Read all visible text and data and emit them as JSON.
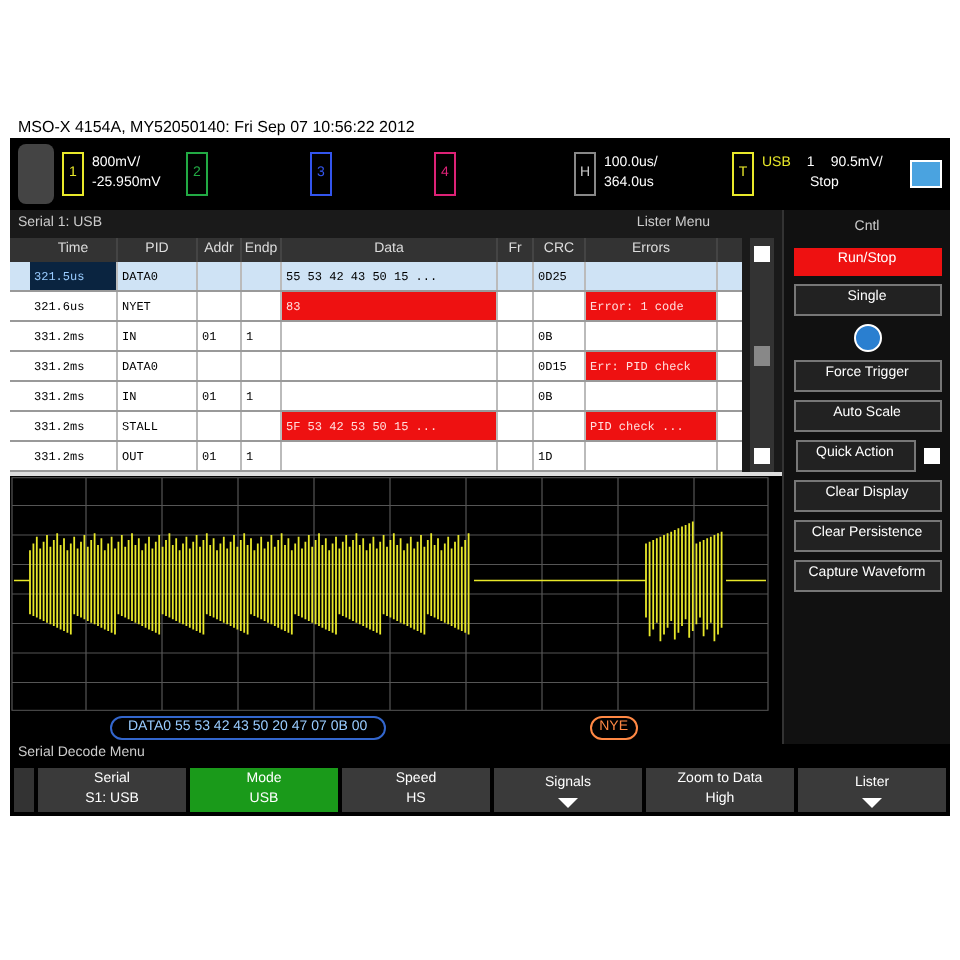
{
  "header": "MSO-X 4154A, MY52050140: Fri Sep 07 10:56:22 2012",
  "channels": [
    {
      "label": "1",
      "color": "#e8e82a",
      "scale": "800mV/",
      "offset": "-25.950mV"
    },
    {
      "label": "2",
      "color": "#22aa44"
    },
    {
      "label": "3",
      "color": "#3355ee"
    },
    {
      "label": "4",
      "color": "#dd2277"
    }
  ],
  "horizontal": {
    "label": "H",
    "scale": "100.0us/",
    "position": "364.0us"
  },
  "trigger": {
    "label": "T",
    "source": "1",
    "mode": "USB",
    "level": "90.5mV/",
    "status": "Stop"
  },
  "lister": {
    "title": "Serial 1: USB",
    "menu": "Lister Menu",
    "columns": [
      "Time",
      "PID",
      "Addr",
      "Endp",
      "Data",
      "Fr",
      "CRC",
      "Errors"
    ],
    "rows": [
      {
        "selected": true,
        "cells": [
          {
            "text": "321.5us"
          },
          {
            "text": "DATA0"
          },
          {
            "text": ""
          },
          {
            "text": ""
          },
          {
            "text": "55 53 42 43 50 15 ..."
          },
          {
            "text": ""
          },
          {
            "text": "0D25"
          },
          {
            "text": ""
          }
        ]
      },
      {
        "selected": false,
        "cells": [
          {
            "text": "321.6us"
          },
          {
            "text": "NYET"
          },
          {
            "text": ""
          },
          {
            "text": ""
          },
          {
            "text": "83",
            "error": true
          },
          {
            "text": ""
          },
          {
            "text": ""
          },
          {
            "text": "Error: 1 code",
            "error": true
          }
        ]
      },
      {
        "selected": false,
        "cells": [
          {
            "text": "331.2ms"
          },
          {
            "text": "IN"
          },
          {
            "text": "01"
          },
          {
            "text": "1"
          },
          {
            "text": ""
          },
          {
            "text": ""
          },
          {
            "text": "0B"
          },
          {
            "text": ""
          }
        ]
      },
      {
        "selected": false,
        "cells": [
          {
            "text": "331.2ms"
          },
          {
            "text": "DATA0"
          },
          {
            "text": ""
          },
          {
            "text": ""
          },
          {
            "text": ""
          },
          {
            "text": ""
          },
          {
            "text": "0D15"
          },
          {
            "text": "Err: PID check",
            "error": true
          }
        ]
      },
      {
        "selected": false,
        "cells": [
          {
            "text": "331.2ms"
          },
          {
            "text": "IN"
          },
          {
            "text": "01"
          },
          {
            "text": "1"
          },
          {
            "text": ""
          },
          {
            "text": ""
          },
          {
            "text": "0B"
          },
          {
            "text": ""
          }
        ]
      },
      {
        "selected": false,
        "cells": [
          {
            "text": "331.2ms"
          },
          {
            "text": "STALL"
          },
          {
            "text": ""
          },
          {
            "text": ""
          },
          {
            "text": "5F 53 42 53 50 15 ...",
            "error": true
          },
          {
            "text": ""
          },
          {
            "text": ""
          },
          {
            "text": "PID check ...",
            "error": true
          }
        ]
      },
      {
        "selected": false,
        "cells": [
          {
            "text": "331.2ms"
          },
          {
            "text": "OUT"
          },
          {
            "text": "01"
          },
          {
            "text": "1"
          },
          {
            "text": ""
          },
          {
            "text": ""
          },
          {
            "text": "1D"
          },
          {
            "text": ""
          }
        ]
      }
    ]
  },
  "control": {
    "title": "Cntl",
    "buttons": [
      {
        "label": "Run/Stop",
        "kind": "run"
      },
      {
        "label": "Single",
        "kind": "normal"
      },
      {
        "kind": "help"
      },
      {
        "label": "Force Trigger",
        "kind": "normal"
      },
      {
        "label": "Auto Scale",
        "kind": "normal"
      },
      {
        "label": "Quick Action",
        "kind": "quick"
      },
      {
        "label": "Clear Display",
        "kind": "normal"
      },
      {
        "label": "Clear Persistence",
        "kind": "normal"
      },
      {
        "label": "Capture Waveform",
        "kind": "normal"
      }
    ]
  },
  "decode": {
    "packet": "DATA0 55 53 42 43 50 20 47 07 0B 00",
    "tag": "NYE"
  },
  "menu_title": "Serial Decode Menu",
  "softkeys": [
    {
      "title": "Serial",
      "value": "S1: USB",
      "selected": false,
      "kind": "value"
    },
    {
      "title": "Mode",
      "value": "USB",
      "selected": true,
      "kind": "value"
    },
    {
      "title": "Speed",
      "value": "HS",
      "selected": false,
      "kind": "value"
    },
    {
      "title": "Signals",
      "selected": false,
      "kind": "submenu"
    },
    {
      "title": "Zoom to Data",
      "value": "High",
      "selected": false,
      "kind": "value"
    },
    {
      "title": "Lister",
      "selected": false,
      "kind": "submenu"
    }
  ]
}
